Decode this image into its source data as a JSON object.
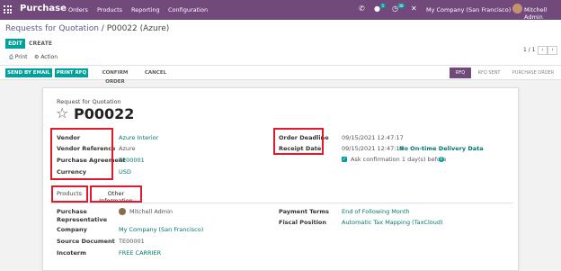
{
  "navbar": {
    "app_name": "Purchase",
    "menu": [
      "Orders",
      "Products",
      "Reporting",
      "Configuration"
    ],
    "company": "My Company (San Francisco)",
    "user": "Mitchell Admin",
    "messages_badge": "5",
    "activities_badge": "38",
    "icons": [
      "apps-icon",
      "phone-icon",
      "chat-icon",
      "clock-icon",
      "close-icon"
    ]
  },
  "breadcrumb": {
    "parent": "Requests for Quotation",
    "separator": " / ",
    "current": "P00022 (Azure)"
  },
  "buttons": {
    "edit": "EDIT",
    "create": "CREATE",
    "print": "Print",
    "action": "Action"
  },
  "pager": {
    "value": "1 / 1",
    "prev": "‹",
    "next": "›"
  },
  "statusbar": {
    "send_by_email": "SEND BY EMAIL",
    "print_rfq": "PRINT RFQ",
    "confirm_order": "CONFIRM ORDER",
    "cancel": "CANCEL",
    "stages": [
      "RFQ",
      "RFQ SENT",
      "PURCHASE ORDER"
    ],
    "active_stage": "RFQ"
  },
  "sheet": {
    "doc_type": "Request for Quotation",
    "name": "P00022",
    "star": "☆",
    "fields_left": [
      {
        "label": "Vendor",
        "value": "Azure Interior",
        "link": true
      },
      {
        "label": "Vendor Reference",
        "value": "Azure",
        "link": false
      },
      {
        "label": "Purchase Agreement",
        "value": "TE00001",
        "link": true
      },
      {
        "label": "Currency",
        "value": "USD",
        "link": true
      }
    ],
    "order_deadline": {
      "label": "Order Deadline",
      "value": "09/15/2021 12:47:17"
    },
    "receipt_date": {
      "label": "Receipt Date",
      "value": "09/15/2021 12:47:17",
      "badge": "No On-time Delivery Data"
    },
    "ask_confirmation": {
      "prefix": "Ask confirmation",
      "days": "1",
      "suffix": "day(s) before",
      "checked": true
    },
    "tabs": [
      "Products",
      "Other Information"
    ],
    "other_info_left": [
      {
        "label": "Purchase\nRepresentative",
        "value": "Mitchell Admin",
        "link": false
      },
      {
        "label": "Company",
        "value": "My Company (San Francisco)",
        "link": true
      },
      {
        "label": "Source Document",
        "value": "TE00001",
        "link": false
      },
      {
        "label": "Incoterm",
        "value": "FREE CARRIER",
        "link": true
      }
    ],
    "other_info_right": [
      {
        "label": "Payment Terms",
        "value": "End of Following Month",
        "link": true
      },
      {
        "label": "Fiscal Position",
        "value": "Automatic Tax Mapping (TaxCloud)",
        "link": true
      }
    ]
  },
  "colors": {
    "brand": "#71497b",
    "primary": "#00a09d",
    "highlight": "#e11a2b"
  }
}
